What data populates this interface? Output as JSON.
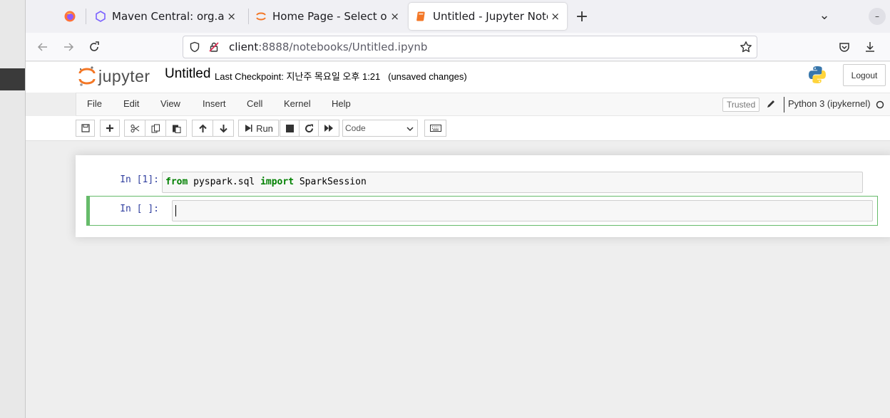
{
  "browser": {
    "tabs": [
      {
        "title": "",
        "icon": "firefox-icon",
        "active": false
      },
      {
        "title": "Maven Central: org.apach",
        "icon": "maven-icon",
        "active": false
      },
      {
        "title": "Home Page - Select or cre",
        "icon": "jupyter-icon",
        "active": false
      },
      {
        "title": "Untitled - Jupyter Notebo",
        "icon": "notebook-icon",
        "active": true
      }
    ],
    "close_glyph": "×",
    "new_tab_glyph": "+",
    "list_tabs_glyph": "⌄",
    "minimize_glyph": "–",
    "url": {
      "host": "client",
      "rest": ":8888/notebooks/Untitled.ipynb"
    }
  },
  "jupyter": {
    "logo_text": "jupyter",
    "notebook_name": "Untitled",
    "checkpoint_text": "Last Checkpoint: 지난주 목요일 오후 1:21",
    "unsaved_text": "(unsaved changes)",
    "logout_label": "Logout",
    "menu": [
      "File",
      "Edit",
      "View",
      "Insert",
      "Cell",
      "Kernel",
      "Help"
    ],
    "trusted_label": "Trusted",
    "kernel_name": "Python 3 (ipykernel)",
    "toolbar": {
      "run_label": "Run",
      "cell_type": "Code"
    },
    "cells": [
      {
        "prompt": "In [1]:",
        "code": [
          {
            "text": "from",
            "kw": true
          },
          {
            "text": " pyspark.sql ",
            "kw": false
          },
          {
            "text": "import",
            "kw": true
          },
          {
            "text": " SparkSession",
            "kw": false
          }
        ],
        "selected": false
      },
      {
        "prompt": "In [ ]:",
        "code": [],
        "selected": true
      }
    ]
  },
  "colors": {
    "prompt": "#303f9f",
    "keyword": "#008000",
    "selected_cell_border": "#66bb6a",
    "jupyter_orange": "#f37726"
  }
}
